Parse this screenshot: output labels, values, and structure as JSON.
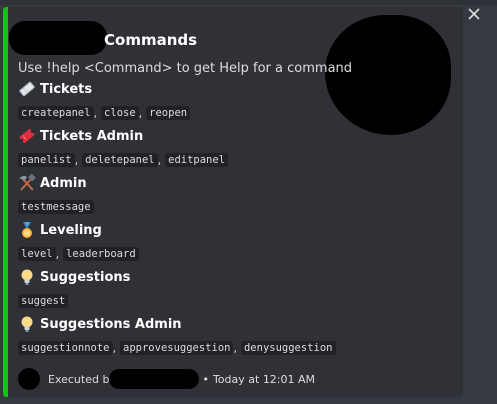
{
  "embed": {
    "accent_color": "#13c213",
    "title": "Commands",
    "description": "Use !help <Command> to get Help for a command",
    "fields": [
      {
        "icon": "ticket-icon",
        "name": "Tickets",
        "commands": [
          "createpanel",
          "close",
          "reopen"
        ]
      },
      {
        "icon": "admission-ticket-icon",
        "name": "Tickets Admin",
        "commands": [
          "panelist",
          "deletepanel",
          "editpanel"
        ]
      },
      {
        "icon": "hammer-and-pick-icon",
        "name": "Admin",
        "commands": [
          "testmessage"
        ]
      },
      {
        "icon": "medal-icon",
        "name": "Leveling",
        "commands": [
          "level",
          "leaderboard"
        ]
      },
      {
        "icon": "light-bulb-icon",
        "name": "Suggestions",
        "commands": [
          "suggest"
        ]
      },
      {
        "icon": "light-bulb-icon",
        "name": "Suggestions Admin",
        "commands": [
          "suggestionnote",
          "approvesuggestion",
          "denysuggestion"
        ]
      }
    ],
    "footer": {
      "executed_label": "Executed b",
      "bullet": "•",
      "timestamp": "Today at 12:01 AM"
    }
  },
  "close_glyph": "✕"
}
